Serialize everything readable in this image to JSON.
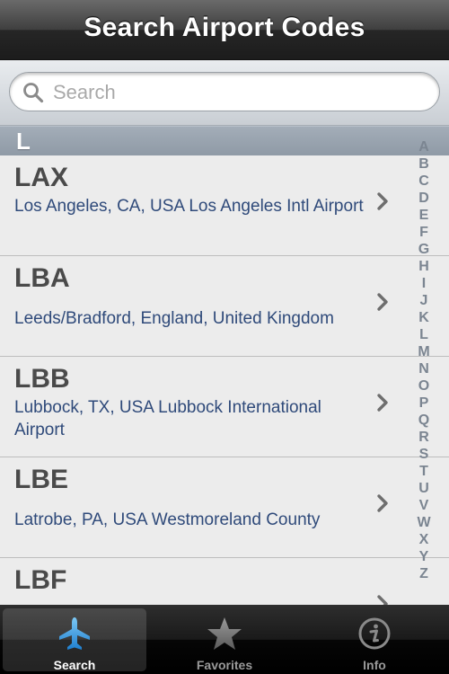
{
  "navbar": {
    "title": "Search Airport Codes"
  },
  "search": {
    "placeholder": "Search"
  },
  "section": {
    "letter": "L"
  },
  "rows": [
    {
      "code": "LAX",
      "desc": "Los Angeles, CA, USA Los Angeles Intl Airport"
    },
    {
      "code": "LBA",
      "desc": "Leeds/Bradford, England, United Kingdom"
    },
    {
      "code": "LBB",
      "desc": "Lubbock, TX, USA Lubbock International Airport"
    },
    {
      "code": "LBE",
      "desc": "Latrobe, PA, USA Westmoreland County"
    },
    {
      "code": "LBF",
      "desc": ""
    }
  ],
  "index_letters": [
    "A",
    "B",
    "C",
    "D",
    "E",
    "F",
    "G",
    "H",
    "I",
    "J",
    "K",
    "L",
    "M",
    "N",
    "O",
    "P",
    "Q",
    "R",
    "S",
    "T",
    "U",
    "V",
    "W",
    "X",
    "Y",
    "Z"
  ],
  "tabs": [
    {
      "label": "Search",
      "icon": "airplane-icon",
      "active": true
    },
    {
      "label": "Favorites",
      "icon": "star-icon",
      "active": false
    },
    {
      "label": "Info",
      "icon": "info-icon",
      "active": false
    }
  ],
  "colors": {
    "accent": "#3a9bdc",
    "link_text": "#2f4a7a"
  }
}
